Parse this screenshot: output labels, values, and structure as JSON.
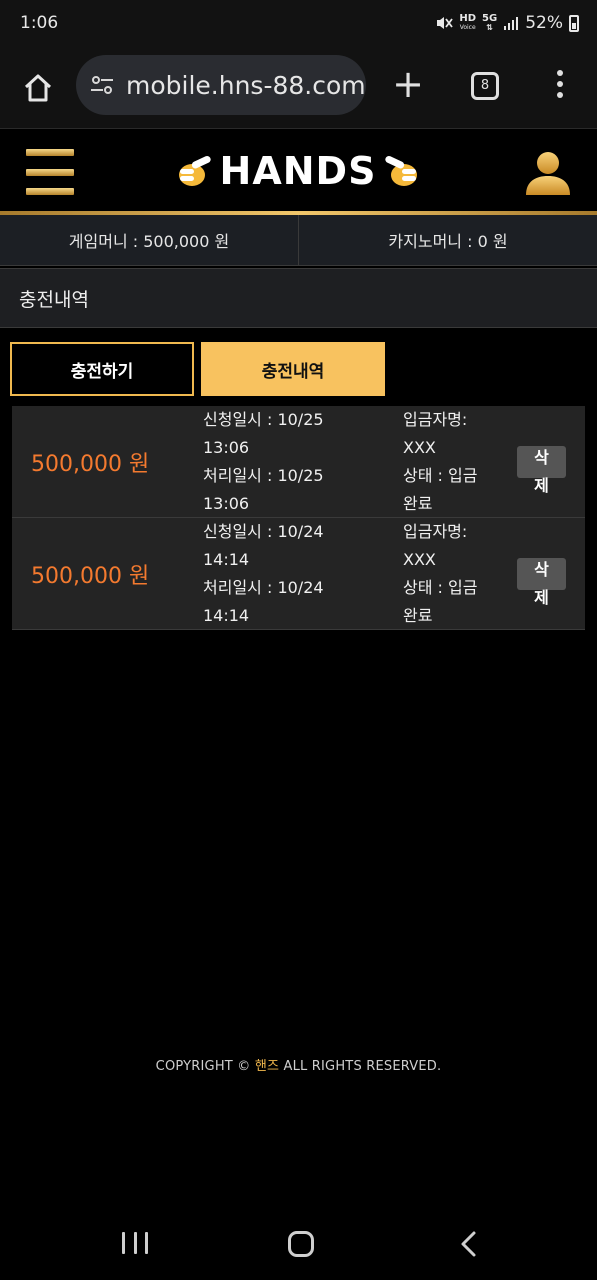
{
  "status_bar": {
    "time": "1:06",
    "hd": "HD",
    "voice": "Voice",
    "network": "5G",
    "battery": "52%"
  },
  "browser": {
    "url": "mobile.hns-88.com",
    "tab_count": "8"
  },
  "site": {
    "logo_text": "HANDS",
    "accent_color": "#f8c25f"
  },
  "money": {
    "game_money": "게임머니 : 500,000 원",
    "casino_money": "카지노머니 : 0 원"
  },
  "page_title": "충전내역",
  "tabs": [
    {
      "label": "충전하기"
    },
    {
      "label": "충전내역"
    }
  ],
  "history": [
    {
      "amount": "500,000 원",
      "request_label": "신청일시 : 10/25",
      "request_time": "13:06",
      "process_label": "처리일시 : 10/25",
      "process_time": "13:06",
      "depositor_label": "입금자명:",
      "depositor": "XXX",
      "status_label": "상태 : 입금",
      "status_value": "완료",
      "delete_label": "삭제"
    },
    {
      "amount": "500,000 원",
      "request_label": "신청일시 : 10/24",
      "request_time": "14:14",
      "process_label": "처리일시 : 10/24",
      "process_time": "14:14",
      "depositor_label": "입금자명:",
      "depositor": "XXX",
      "status_label": "상태 : 입금",
      "status_value": "완료",
      "delete_label": "삭제"
    }
  ],
  "footer": {
    "prefix": "COPYRIGHT © ",
    "brand": "핸즈",
    "suffix": " ALL RIGHTS RESERVED."
  }
}
